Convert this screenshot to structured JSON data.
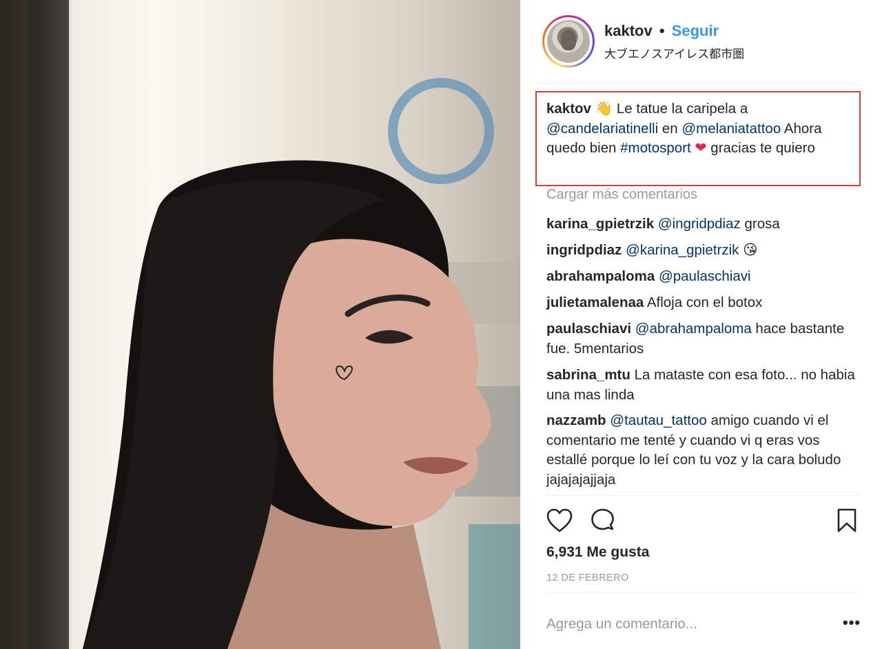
{
  "header": {
    "username": "kaktov",
    "separator": "•",
    "follow_label": "Seguir",
    "location": "大ブエノスアイレス都市圏"
  },
  "caption": {
    "username": "kaktov",
    "emoji": "👋",
    "text_1": " Le tatue la caripela a ",
    "mention_1": "@candelariatinelli",
    "text_2": " en ",
    "mention_2": "@melaniatattoo",
    "text_3": " Ahora quedo bien ",
    "hashtag": "#motosport",
    "heart": "❤",
    "text_4": " gracias te quiero"
  },
  "load_more_label": "Cargar más comentarios",
  "comments": [
    {
      "user": "karina_gpietrzik",
      "mention": "@ingridpdiaz",
      "text": " grosa"
    },
    {
      "user": "ingridpdiaz",
      "mention": "@karina_gpietrzik",
      "text": " 😘"
    },
    {
      "user": "abrahampaloma",
      "mention": "@paulaschiavi",
      "text": ""
    },
    {
      "user": "julietamalenaa",
      "mention": "",
      "text": " Afloja con el botox"
    },
    {
      "user": "paulaschiavi",
      "mention": "@abrahampaloma",
      "text": " hace bastante fue. 5mentarios"
    },
    {
      "user": "sabrina_mtu",
      "mention": "",
      "text": " La mataste con esa foto... no habia una mas linda"
    },
    {
      "user": "nazzamb",
      "mention": "@tautau_tattoo",
      "text": " amigo cuando vi el comentario me tenté y cuando vi q eras vos estallé porque lo leí con tu voz y la cara boludo jajajajajjaja"
    }
  ],
  "actions": {
    "like_icon": "heart-outline-icon",
    "comment_icon": "speech-bubble-icon",
    "save_icon": "bookmark-icon"
  },
  "likes_label": "6,931 Me gusta",
  "date_label": "12 DE FEBRERO",
  "add_comment_placeholder": "Agrega un comentario...",
  "more_options_label": "•••",
  "colors": {
    "link": "#3897f0",
    "mention": "#003569",
    "muted": "#999999",
    "highlight_border": "#d63a3a"
  }
}
